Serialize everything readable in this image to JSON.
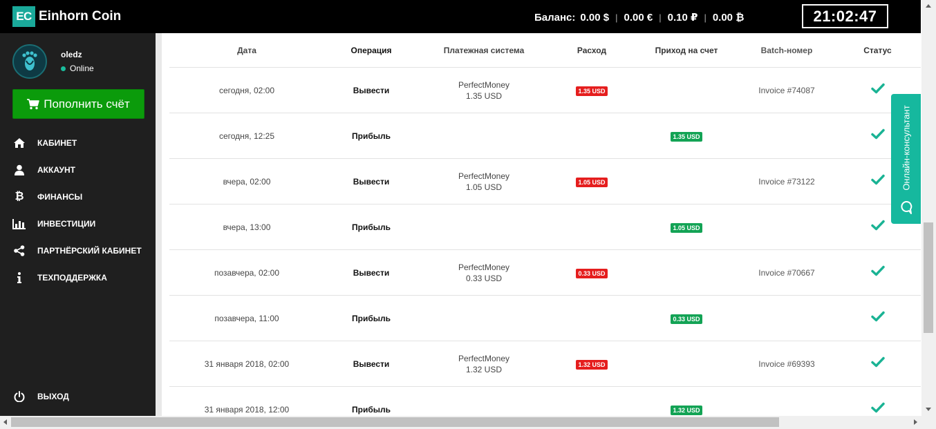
{
  "brand": {
    "logo_abbr": "EC",
    "name": "Einhorn Coin"
  },
  "user": {
    "name": "oledz",
    "status": "Online"
  },
  "sidebar": {
    "topup_label": "Пополнить счёт",
    "items": [
      {
        "label": "Кабинет",
        "icon": "home-icon"
      },
      {
        "label": "Аккаунт",
        "icon": "user-icon"
      },
      {
        "label": "Финансы",
        "icon": "bitcoin-icon"
      },
      {
        "label": "Инвестиции",
        "icon": "bar-chart-icon"
      },
      {
        "label": "Партнёрский кабинет",
        "icon": "share-icon"
      },
      {
        "label": "Техподдержка",
        "icon": "info-icon"
      }
    ],
    "logout_label": "Выход"
  },
  "header": {
    "balance_label": "Баланс:",
    "balances": [
      "0.00 $",
      "0.00 €",
      "0.10 ₽",
      "0.00 ₿"
    ],
    "clock": "21:02:47"
  },
  "table": {
    "columns": [
      "Дата",
      "Операция",
      "Платежная система",
      "Расход",
      "Приход на счет",
      "Batch-номер",
      "Статус"
    ],
    "rows": [
      {
        "date": "сегодня, 02:00",
        "operation": "Вывести",
        "system": "PerfectMoney",
        "system_amount": "1.35 USD",
        "expense": "1.35 USD",
        "income": "",
        "batch": "Invoice #74087"
      },
      {
        "date": "сегодня, 12:25",
        "operation": "Прибыль",
        "system": "",
        "system_amount": "",
        "expense": "",
        "income": "1.35 USD",
        "batch": ""
      },
      {
        "date": "вчера, 02:00",
        "operation": "Вывести",
        "system": "PerfectMoney",
        "system_amount": "1.05 USD",
        "expense": "1.05 USD",
        "income": "",
        "batch": "Invoice #73122"
      },
      {
        "date": "вчера, 13:00",
        "operation": "Прибыль",
        "system": "",
        "system_amount": "",
        "expense": "",
        "income": "1.05 USD",
        "batch": ""
      },
      {
        "date": "позавчера, 02:00",
        "operation": "Вывести",
        "system": "PerfectMoney",
        "system_amount": "0.33 USD",
        "expense": "0.33 USD",
        "income": "",
        "batch": "Invoice #70667"
      },
      {
        "date": "позавчера, 11:00",
        "operation": "Прибыль",
        "system": "",
        "system_amount": "",
        "expense": "",
        "income": "0.33 USD",
        "batch": ""
      },
      {
        "date": "31 января 2018, 02:00",
        "operation": "Вывести",
        "system": "PerfectMoney",
        "system_amount": "1.32 USD",
        "expense": "1.32 USD",
        "income": "",
        "batch": "Invoice #69393"
      },
      {
        "date": "31 января 2018, 12:00",
        "operation": "Прибыль",
        "system": "",
        "system_amount": "",
        "expense": "",
        "income": "1.32 USD",
        "batch": ""
      }
    ]
  },
  "consultant": {
    "label": "Онлайн-консультант"
  },
  "colors": {
    "accent": "#16b89e",
    "topup": "#0b9b0b",
    "expense": "#e51e1e",
    "income": "#13a355",
    "sidebar": "#1f1f1f"
  }
}
